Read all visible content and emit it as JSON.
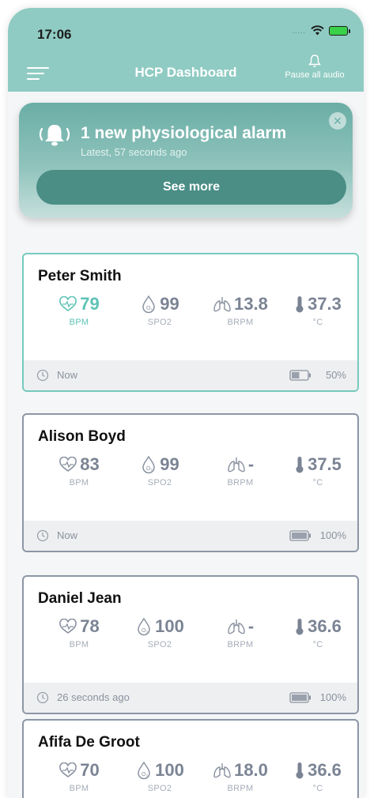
{
  "status_bar": {
    "time": "17:06",
    "signal": "....."
  },
  "header": {
    "title": "HCP Dashboard",
    "pause_label": "Pause all audio"
  },
  "alarm": {
    "title": "1 new physiological alarm",
    "subtitle": "Latest, 57 seconds ago",
    "button": "See more",
    "close": "✕"
  },
  "patients": [
    {
      "name": "Peter Smith",
      "hr": "79",
      "hr_unit": "BPM",
      "spo2": "99",
      "spo2_unit": "SPO2",
      "br": "13.8",
      "br_unit": "BRPM",
      "temp": "37.3",
      "temp_unit": "°C",
      "time": "Now",
      "battery": "50%",
      "battery_level": 0.5,
      "active": true
    },
    {
      "name": "Alison Boyd",
      "hr": "83",
      "hr_unit": "BPM",
      "spo2": "99",
      "spo2_unit": "SPO2",
      "br": "-",
      "br_unit": "BRPM",
      "temp": "37.5",
      "temp_unit": "°C",
      "time": "Now",
      "battery": "100%",
      "battery_level": 1.0
    },
    {
      "name": "Daniel Jean",
      "hr": "78",
      "hr_unit": "BPM",
      "spo2": "100",
      "spo2_unit": "SPO2",
      "br": "-",
      "br_unit": "BRPM",
      "temp": "36.6",
      "temp_unit": "°C",
      "time": "26 seconds ago",
      "battery": "100%",
      "battery_level": 1.0
    },
    {
      "name": "Afifa De Groot",
      "hr": "70",
      "hr_unit": "BPM",
      "spo2": "100",
      "spo2_unit": "SPO2",
      "br": "18.0",
      "br_unit": "BRPM",
      "temp": "36.6",
      "temp_unit": "°C"
    }
  ],
  "colors": {
    "header": "#8fcbc2",
    "accent": "#5cc3b6",
    "muted": "#7b8494",
    "alarm_button": "#4a8e86"
  },
  "icons": [
    "menu-icon",
    "bell-icon",
    "alarm-bell-icon",
    "close-icon",
    "heart-icon",
    "spo2-drop-icon",
    "lungs-icon",
    "thermometer-icon",
    "clock-icon",
    "battery-icon",
    "wifi-icon"
  ]
}
